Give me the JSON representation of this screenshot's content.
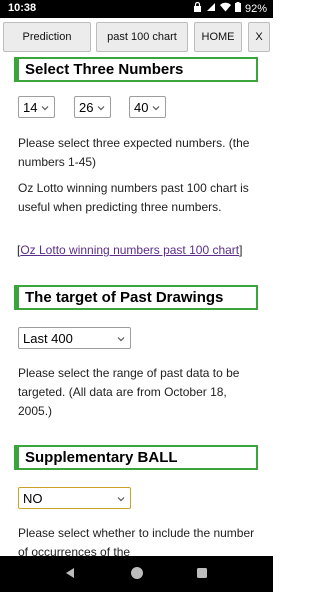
{
  "status": {
    "time": "10:38",
    "battery": "92%"
  },
  "nav": {
    "prediction": "Prediction",
    "chart": "past 100 chart",
    "home": "HOME",
    "close": "X"
  },
  "section1": {
    "title": "Select Three Numbers",
    "num1": "14",
    "num2": "26",
    "num3": "40",
    "desc": "Please select three expected numbers. (the numbers 1-45)",
    "chart_note": "Oz Lotto winning numbers past 100 chart is useful when predicting three numbers.",
    "link_open": "[",
    "link_text": "Oz Lotto winning numbers past 100 chart",
    "link_close": "]"
  },
  "section2": {
    "title": "The target of Past Drawings",
    "range": "Last 400",
    "desc": "Please select the range of past data to be targeted. (All data are from October 18, 2005.)"
  },
  "section3": {
    "title": "Supplementary BALL",
    "value": "NO",
    "desc": "Please select whether to include the number of occurrences of the"
  },
  "colors": {
    "accent_green": "#3aa53a",
    "link_purple": "#5b2c8a",
    "select_gold": "#c9a227"
  },
  "icons": [
    "lock-icon",
    "signal-icon",
    "wifi-icon",
    "battery-icon",
    "chevron-down-icon",
    "back-icon",
    "home-circle-icon",
    "recents-icon"
  ]
}
